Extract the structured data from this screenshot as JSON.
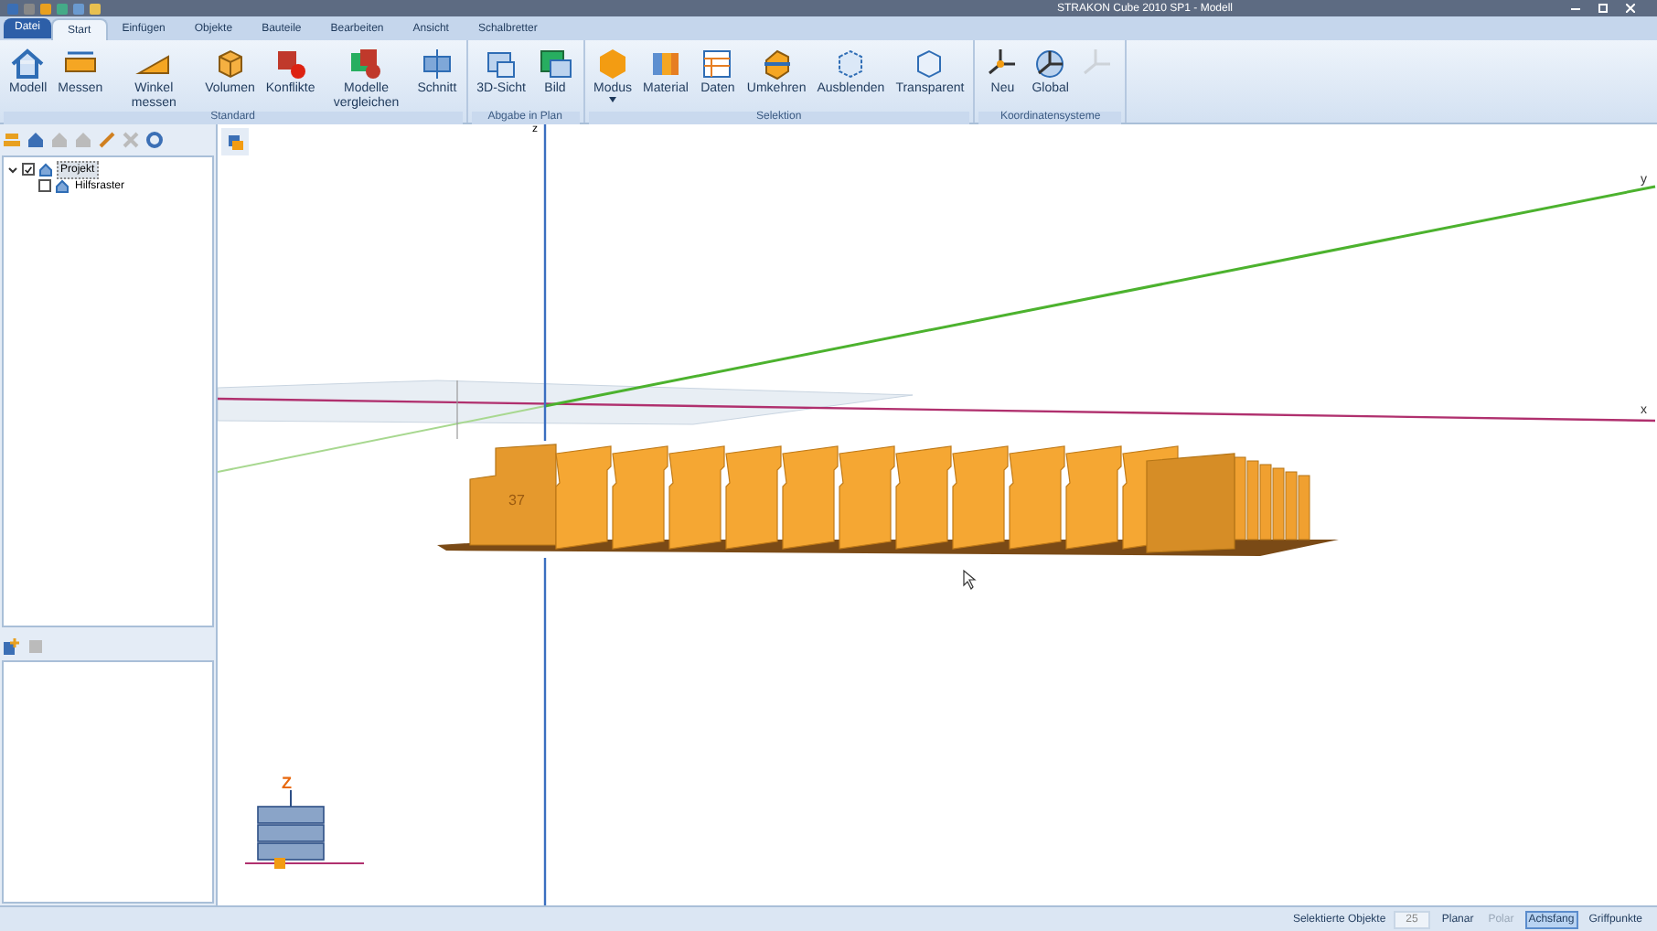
{
  "window": {
    "title": "STRAKON Cube 2010 SP1 - Modell"
  },
  "file_tab": "Datei",
  "tabs": [
    {
      "label": "Start",
      "selected": true
    },
    {
      "label": "Einfügen",
      "selected": false
    },
    {
      "label": "Objekte",
      "selected": false
    },
    {
      "label": "Bauteile",
      "selected": false
    },
    {
      "label": "Bearbeiten",
      "selected": false
    },
    {
      "label": "Ansicht",
      "selected": false
    },
    {
      "label": "Schalbretter",
      "selected": false
    }
  ],
  "ribbon_groups": [
    {
      "title": "Standard",
      "buttons": [
        {
          "label": "Modell",
          "disabled": false
        },
        {
          "label": "Messen",
          "disabled": false
        },
        {
          "label": "Winkel messen",
          "disabled": false
        },
        {
          "label": "Volumen",
          "disabled": false
        },
        {
          "label": "Konflikte",
          "disabled": false
        },
        {
          "label": "Modelle vergleichen",
          "disabled": false
        },
        {
          "label": "Schnitt",
          "disabled": false
        }
      ]
    },
    {
      "title": "Abgabe in Plan",
      "buttons": [
        {
          "label": "3D-Sicht",
          "disabled": false
        },
        {
          "label": "Bild",
          "disabled": false
        }
      ]
    },
    {
      "title": "Selektion",
      "buttons": [
        {
          "label": "Modus",
          "disabled": false,
          "dropdown": true
        },
        {
          "label": "Material",
          "disabled": false
        },
        {
          "label": "Daten",
          "disabled": false
        },
        {
          "label": "Umkehren",
          "disabled": false
        },
        {
          "label": "Ausblenden",
          "disabled": false
        },
        {
          "label": "Transparent",
          "disabled": false
        }
      ]
    },
    {
      "title": "Koordinatensysteme",
      "buttons": [
        {
          "label": "Neu",
          "disabled": false
        },
        {
          "label": "Global",
          "disabled": false
        },
        {
          "disabled": true
        }
      ]
    }
  ],
  "tree": [
    {
      "label": "Projekt",
      "checked": true,
      "expanded": true,
      "selected": true,
      "children": [
        {
          "label": "Hilfsraster",
          "checked": false,
          "selected": false
        }
      ]
    }
  ],
  "viewport": {
    "axis_labels": [
      "z",
      "y",
      "x"
    ],
    "model_label": "37",
    "orientation_cube_label": "Z"
  },
  "status_bar": {
    "label": "Selektierte Objekte",
    "count": "25",
    "toggles": [
      {
        "label": "Planar",
        "on": true,
        "selected": false
      },
      {
        "label": "Polar",
        "on": false,
        "selected": false
      },
      {
        "label": "Achsfang",
        "on": true,
        "selected": true
      },
      {
        "label": "Griffpunkte",
        "on": true,
        "selected": false
      }
    ]
  }
}
